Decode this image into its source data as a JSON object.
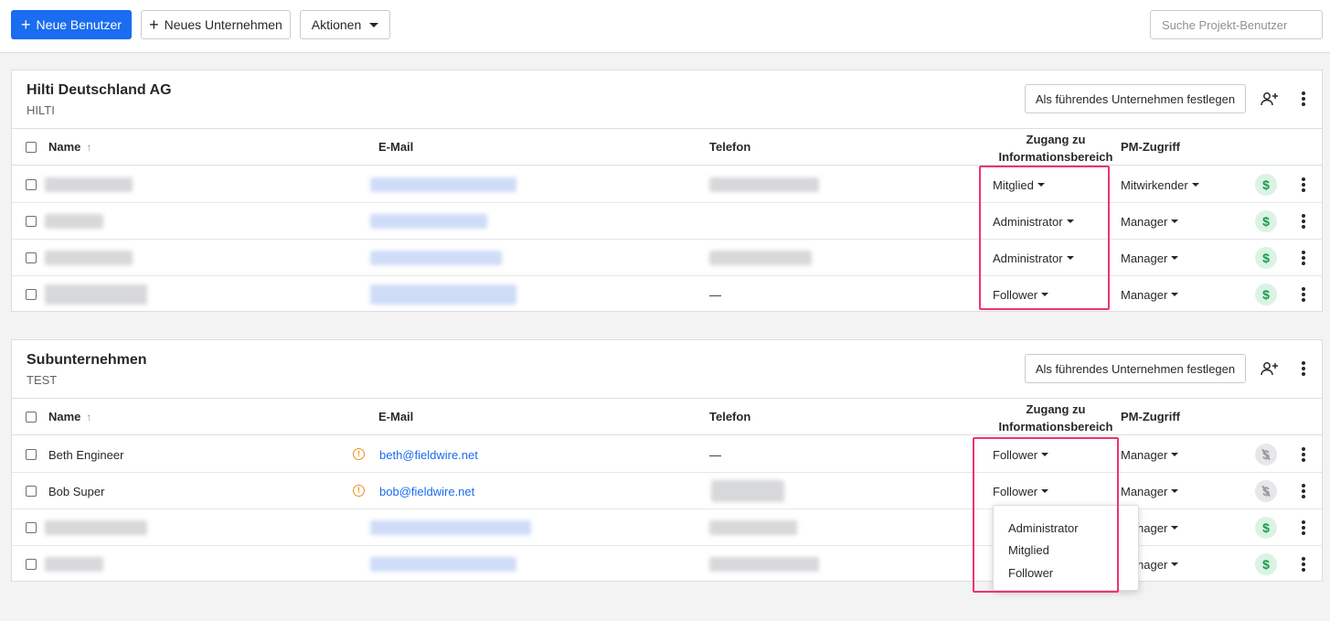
{
  "toolbar": {
    "new_user_label": "Neue Benutzer",
    "new_company_label": "Neues Unternehmen",
    "actions_label": "Aktionen",
    "search_placeholder": "Suche Projekt-Benutzer"
  },
  "columns": {
    "name": "Name",
    "sort_icon": "arrow-up-icon",
    "email": "E-Mail",
    "phone": "Telefon",
    "access_line1": "Zugang zu",
    "access_line2": "Informationsbereich",
    "pm_access": "PM-Zugriff"
  },
  "set_lead_label": "Als führendes Unternehmen festlegen",
  "companies": [
    {
      "name": "Hilti Deutschland AG",
      "code": "HILTI",
      "rows": [
        {
          "name": "",
          "email": "",
          "phone": "",
          "access": "Mitglied",
          "pm": "Mitwirkender",
          "billing": "enabled"
        },
        {
          "name": "",
          "email": "",
          "phone": "",
          "access": "Administrator",
          "pm": "Manager",
          "billing": "enabled"
        },
        {
          "name": "",
          "email": "",
          "phone": "",
          "access": "Administrator",
          "pm": "Manager",
          "billing": "enabled"
        },
        {
          "name": "",
          "email": "",
          "phone": "—",
          "access": "Follower",
          "pm": "Manager",
          "billing": "enabled"
        }
      ]
    },
    {
      "name": "Subunternehmen",
      "code": "TEST",
      "rows": [
        {
          "name": "Beth Engineer",
          "email": "beth@fieldwire.net",
          "phone": "—",
          "access": "Follower",
          "pm": "Manager",
          "billing": "disabled",
          "warning": true
        },
        {
          "name": "Bob Super",
          "email": "bob@fieldwire.net",
          "phone": "",
          "access": "Follower",
          "pm": "Manager",
          "billing": "disabled",
          "warning": true
        },
        {
          "name": "",
          "email": "",
          "phone": "",
          "access": "",
          "pm": "Manager",
          "billing": "enabled"
        },
        {
          "name": "",
          "email": "",
          "phone": "",
          "access": "",
          "pm": "Manager",
          "billing": "enabled"
        }
      ]
    }
  ],
  "access_menu": {
    "options": [
      "Administrator",
      "Mitglied",
      "Follower"
    ]
  },
  "colors": {
    "primary": "#1a6cf0",
    "highlight": "#f0336a",
    "billing_on": "#1b9a4c",
    "warning": "#f08c1a"
  },
  "icons": {
    "dollar": "$",
    "warning": "!"
  }
}
